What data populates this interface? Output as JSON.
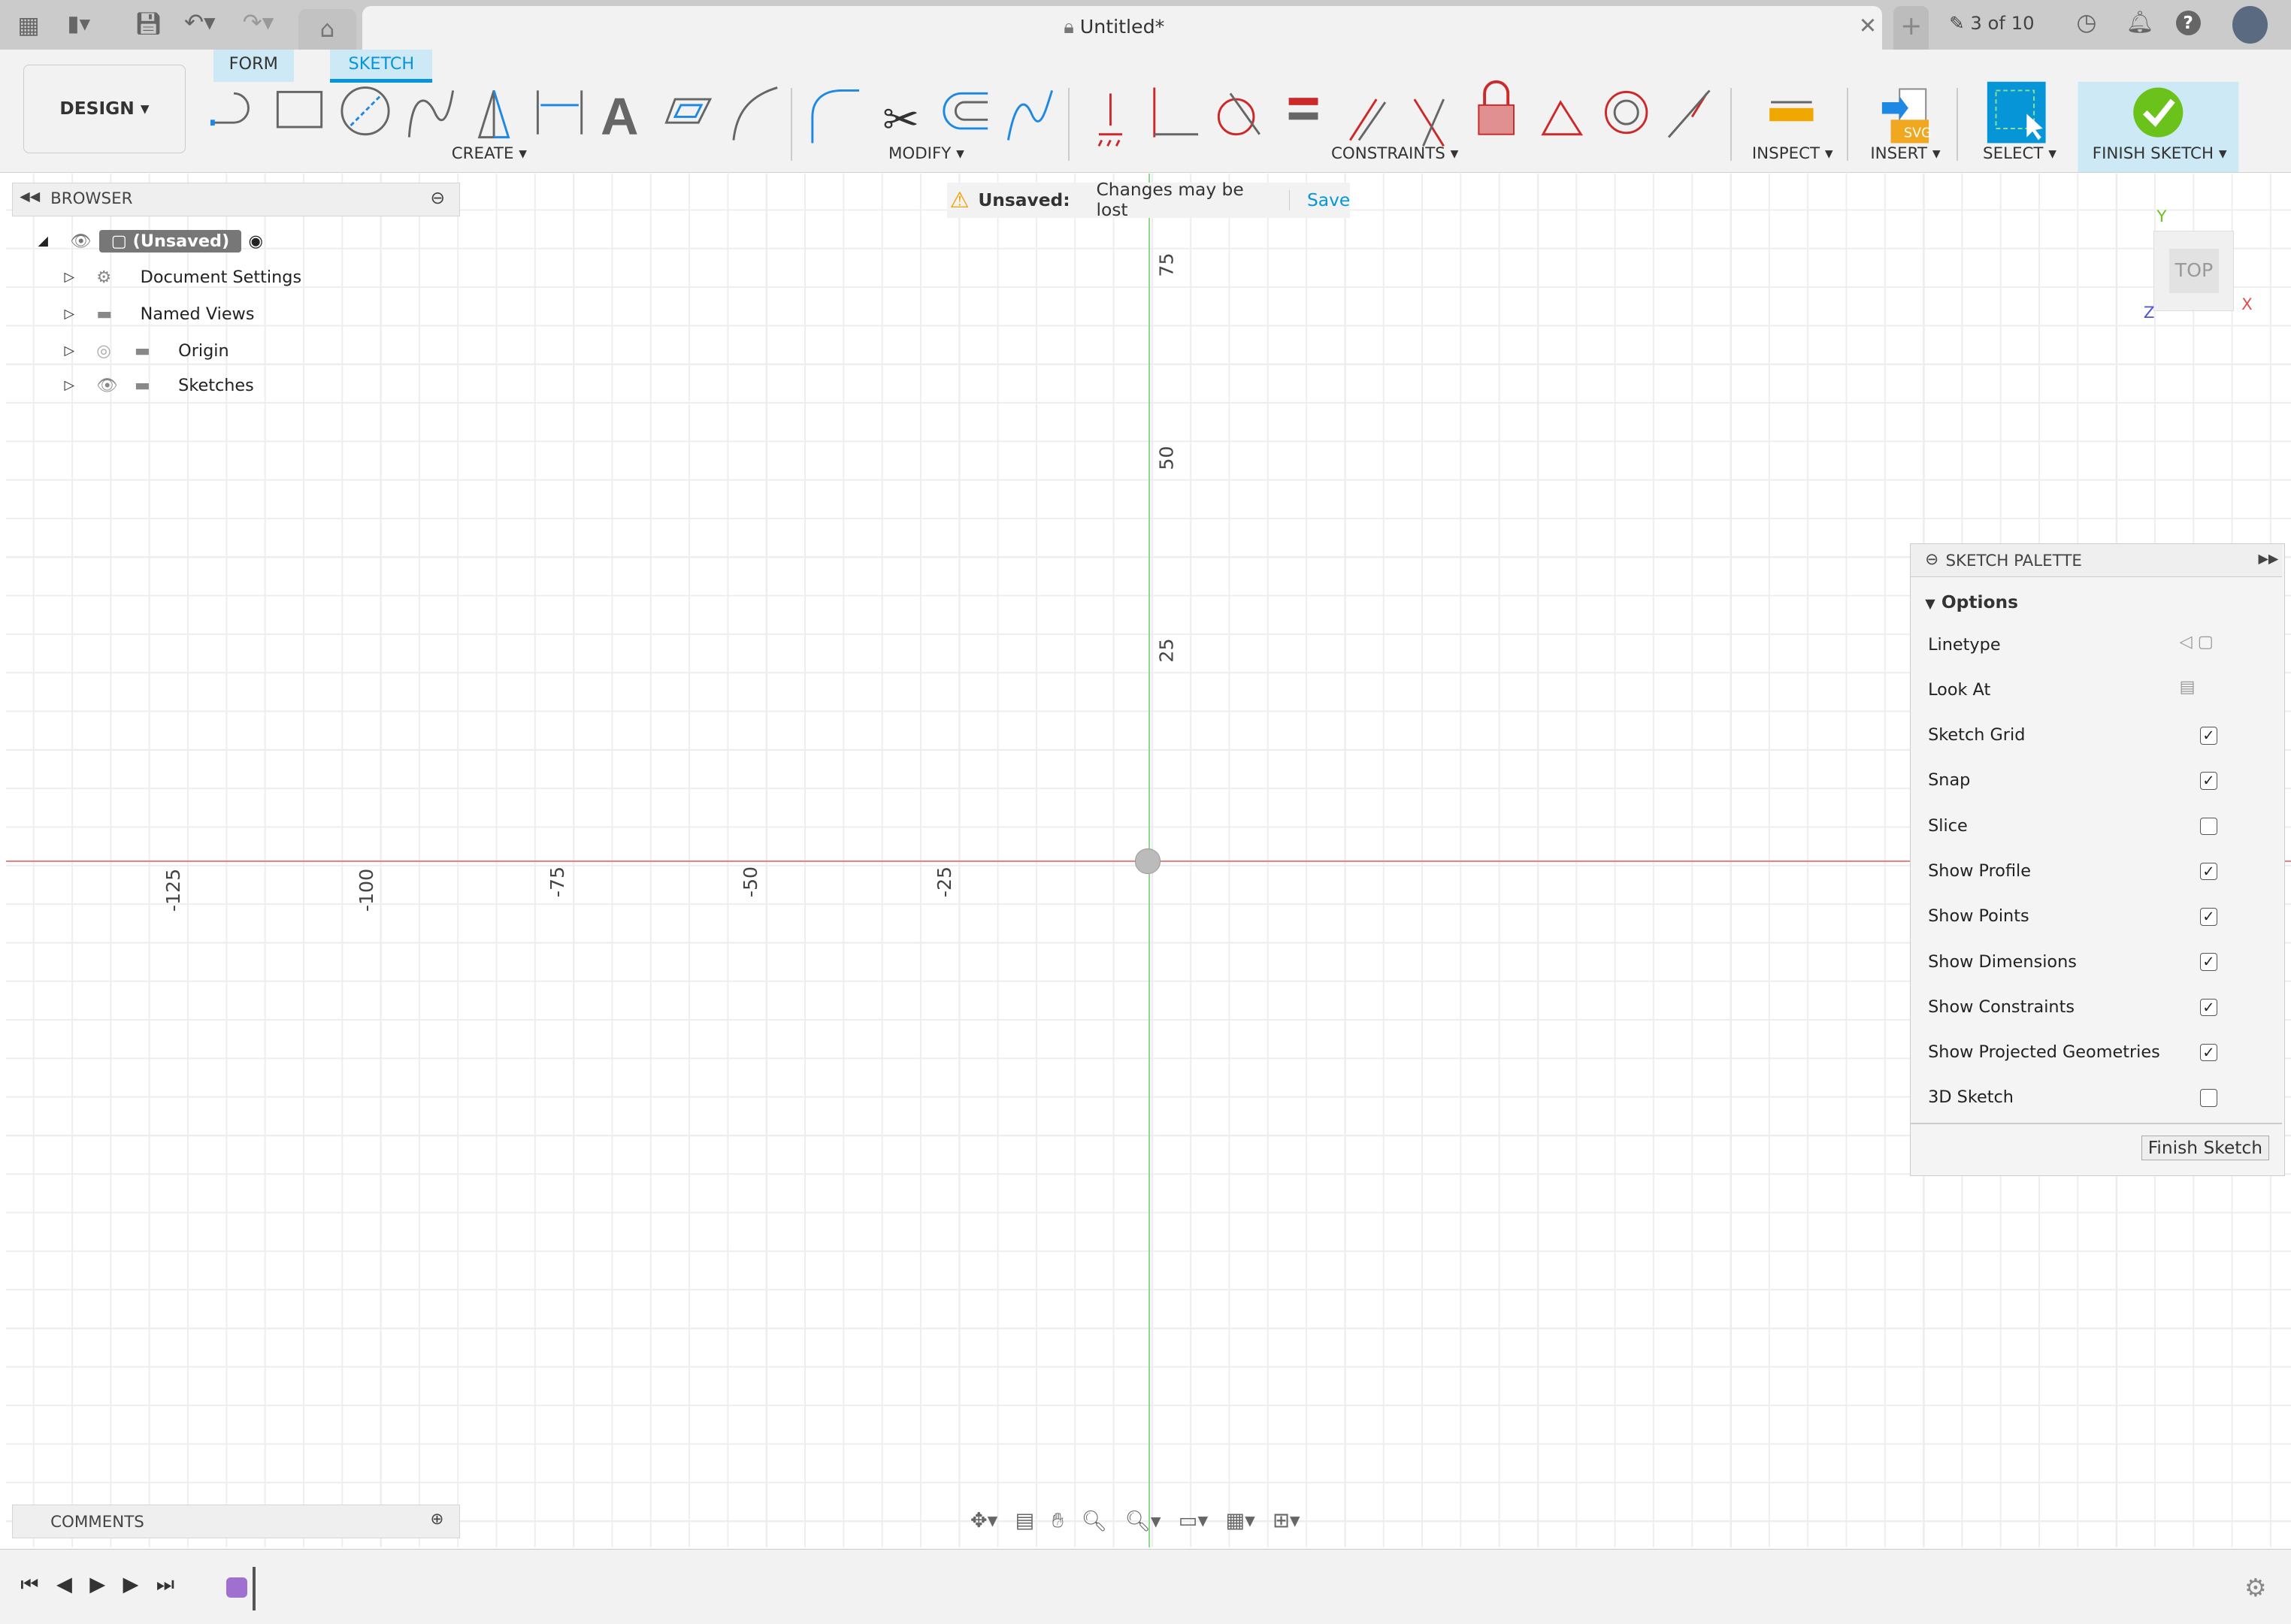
{
  "app": {
    "title": "Untitled*",
    "job_status": "3 of 10"
  },
  "tabs": {
    "form": "FORM",
    "sketch": "SKETCH"
  },
  "workspace": {
    "label": "DESIGN"
  },
  "toolbar_groups": {
    "create": "CREATE",
    "modify": "MODIFY",
    "constraints": "CONSTRAINTS",
    "inspect": "INSPECT",
    "insert": "INSERT",
    "select": "SELECT",
    "finish": "FINISH SKETCH"
  },
  "browser": {
    "title": "BROWSER",
    "root": "(Unsaved)",
    "items": [
      {
        "label": "Document Settings"
      },
      {
        "label": "Named Views"
      },
      {
        "label": "Origin"
      },
      {
        "label": "Sketches"
      }
    ]
  },
  "banner": {
    "label": "Unsaved:",
    "message": "Changes may be lost",
    "save": "Save"
  },
  "viewcube": {
    "face": "TOP",
    "x": "X",
    "y": "Y",
    "z": "Z"
  },
  "axis_labels": {
    "x": [
      "-125",
      "-100",
      "-75",
      "-50",
      "-25"
    ],
    "y": [
      "75",
      "50",
      "25"
    ]
  },
  "palette": {
    "title": "SKETCH PALETTE",
    "section": "Options",
    "rows": [
      {
        "label": "Linetype",
        "type": "icons"
      },
      {
        "label": "Look At",
        "type": "icon"
      },
      {
        "label": "Sketch Grid",
        "checked": true
      },
      {
        "label": "Snap",
        "checked": true
      },
      {
        "label": "Slice",
        "checked": false
      },
      {
        "label": "Show Profile",
        "checked": true
      },
      {
        "label": "Show Points",
        "checked": true
      },
      {
        "label": "Show Dimensions",
        "checked": true
      },
      {
        "label": "Show Constraints",
        "checked": true
      },
      {
        "label": "Show Projected Geometries",
        "checked": true
      },
      {
        "label": "3D Sketch",
        "checked": false
      }
    ],
    "finish": "Finish Sketch"
  },
  "comments": {
    "title": "COMMENTS"
  },
  "colors": {
    "accent": "#0696d7",
    "finish_green": "#6ac21a",
    "x_axis": "#f08080",
    "y_axis": "#90d890",
    "constraint_red": "#cc2a2a"
  }
}
